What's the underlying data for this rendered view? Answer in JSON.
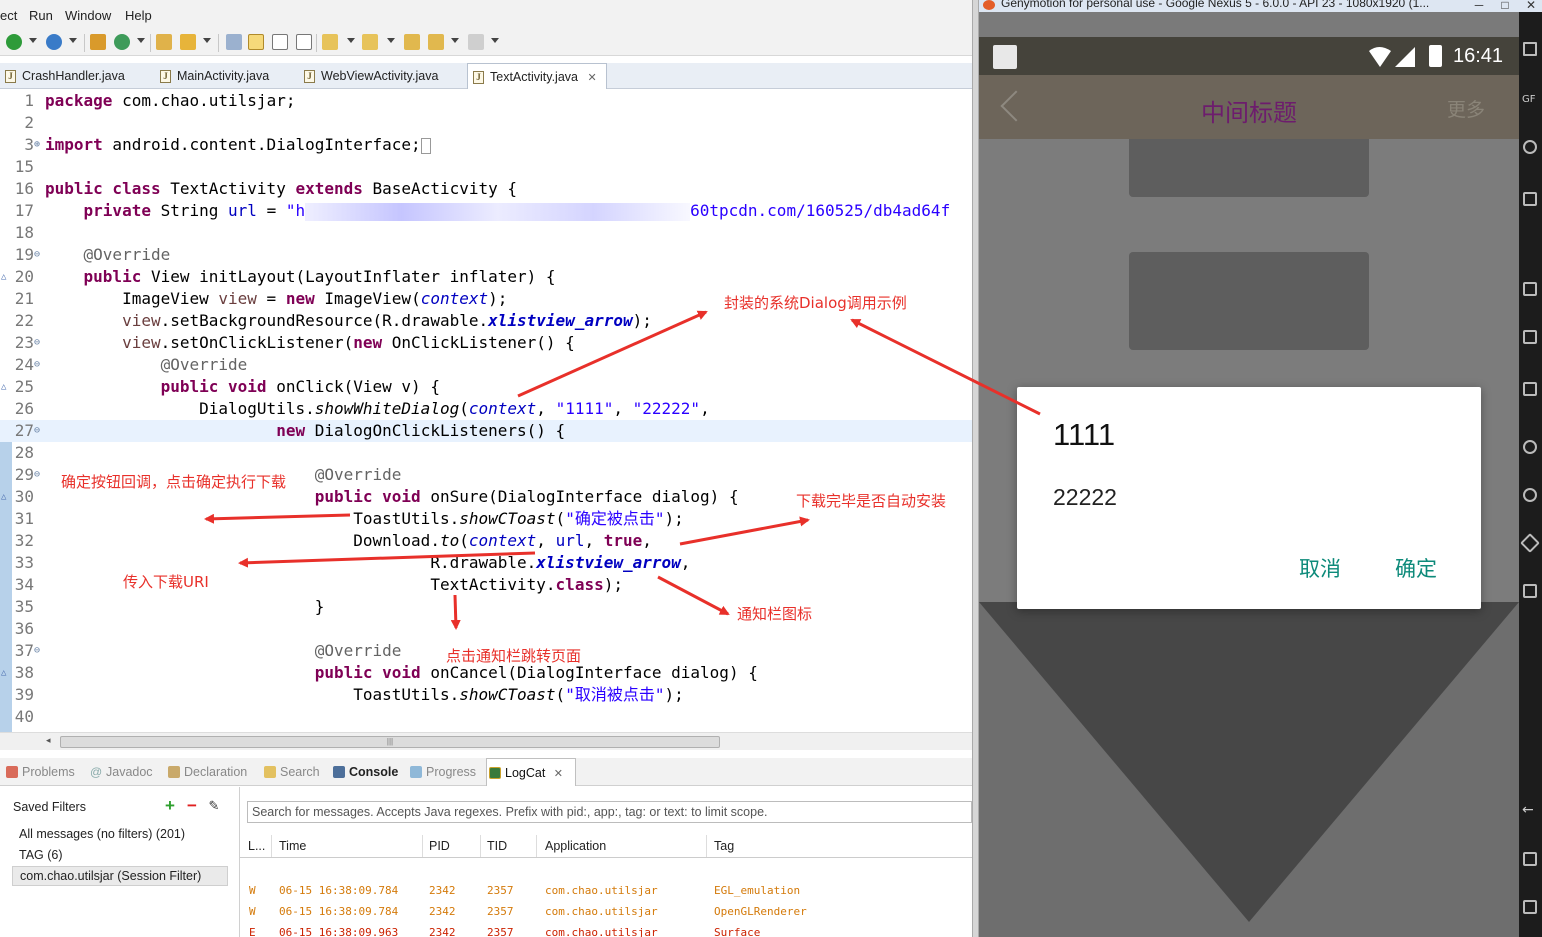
{
  "ide": {
    "menu": [
      "ect",
      "Run",
      "Window",
      "Help"
    ],
    "editor_tabs": [
      "CrashHandler.java",
      "MainActivity.java",
      "WebViewActivity.java",
      "TextActivity.java"
    ],
    "code_lines": [
      {
        "n": "1",
        "html": "<span class='kw'>package</span> com.chao.utilsjar;"
      },
      {
        "n": "2",
        "html": ""
      },
      {
        "n": "3",
        "html": "<span class='kw'>import</span> android.content.DialogInterface;<span style='display:inline-block;width:10px;height:16px;border:1px solid #999;vertical-align:middle;'></span>",
        "fold": "⊕"
      },
      {
        "n": "15",
        "html": ""
      },
      {
        "n": "16",
        "html": "<span class='kw'>public class</span> TextActivity <span class='kw'>extends</span> BaseActicvity {"
      },
      {
        "n": "17",
        "html": "    <span class='kw'>private</span> String <span class='fld'>url</span> = <span class='str'>\"h</span><span class='blur' style='width:385px'></span><span class='str'>60tpcdn.com/160525/db4ad64f</span>"
      },
      {
        "n": "18",
        "html": ""
      },
      {
        "n": "19",
        "html": "    <span class='ann'>@Override</span>",
        "fold": "⊖"
      },
      {
        "n": "20",
        "html": "    <span class='kw'>public</span> View initLayout(LayoutInflater inflater) {",
        "ov": "△"
      },
      {
        "n": "21",
        "html": "        ImageView <span style='color:#6a3e3e'>view</span> = <span class='kw'>new</span> ImageView(<span class='fld st'>context</span>);"
      },
      {
        "n": "22",
        "html": "        <span style='color:#6a3e3e'>view</span>.setBackgroundResource(R.drawable.<span class='sfld'>xlistview_arrow</span>);"
      },
      {
        "n": "23",
        "html": "        <span style='color:#6a3e3e'>view</span>.setOnClickListener(<span class='kw'>new</span> OnClickListener() {",
        "fold": "⊖"
      },
      {
        "n": "24",
        "html": "            <span class='ann'>@Override</span>",
        "fold": "⊖"
      },
      {
        "n": "25",
        "html": "            <span class='kw'>public void</span> onClick(View v) {",
        "ov": "△"
      },
      {
        "n": "26",
        "html": "                DialogUtils.<span class='st'>showWhiteDialog</span>(<span class='fld st'>context</span>, <span class='str'>\"1111\"</span>, <span class='str'>\"22222\"</span>,"
      },
      {
        "n": "27",
        "html": "                        <span class='kw'>new</span> DialogOnClickListeners() {",
        "fold": "⊖",
        "current": true
      },
      {
        "n": "28",
        "html": ""
      },
      {
        "n": "29",
        "html": "                            <span class='ann'>@Override</span>",
        "fold": "⊖"
      },
      {
        "n": "30",
        "html": "                            <span class='kw'>public void</span> onSure(DialogInterface dialog) {",
        "ov": "△"
      },
      {
        "n": "31",
        "html": "                                ToastUtils.<span class='st'>showCToast</span>(<span class='str'>\"确定被点击\"</span>);"
      },
      {
        "n": "32",
        "html": "                                Download.<span class='st'>to</span>(<span class='fld st'>context</span>, <span class='fld'>url</span>, <span class='kw'>true</span>,"
      },
      {
        "n": "33",
        "html": "                                        R.drawable.<span class='sfld'>xlistview_arrow</span>,"
      },
      {
        "n": "34",
        "html": "                                        TextActivity.<span class='kw'>class</span>);"
      },
      {
        "n": "35",
        "html": "                            }"
      },
      {
        "n": "36",
        "html": ""
      },
      {
        "n": "37",
        "html": "                            <span class='ann'>@Override</span>",
        "fold": "⊖"
      },
      {
        "n": "38",
        "html": "                            <span class='kw'>public void</span> onCancel(DialogInterface dialog) {",
        "ov": "△"
      },
      {
        "n": "39",
        "html": "                                ToastUtils.<span class='st'>showCToast</span>(<span class='str'>\"取消被点击\"</span>);"
      },
      {
        "n": "40",
        "html": ""
      }
    ],
    "bottom_tabs": [
      "Problems",
      "Javadoc",
      "Declaration",
      "Search",
      "Console",
      "Progress",
      "LogCat"
    ],
    "saved_filters": {
      "title": "Saved Filters",
      "items": [
        "All messages (no filters) (201)",
        "TAG (6)",
        "com.chao.utilsjar (Session Filter)"
      ]
    },
    "logcat": {
      "search_placeholder": "Search for messages. Accepts Java regexes. Prefix with pid:, app:, tag: or text: to limit scope.",
      "columns": [
        "L...",
        "Time",
        "PID",
        "TID",
        "Application",
        "Tag"
      ],
      "rows": [
        [
          "W",
          "06-15 16:38:09.784",
          "2342",
          "2357",
          "com.chao.utilsjar",
          "EGL_emulation"
        ],
        [
          "W",
          "06-15 16:38:09.784",
          "2342",
          "2357",
          "com.chao.utilsjar",
          "OpenGLRenderer"
        ],
        [
          "E",
          "06-15 16:38:09.963",
          "2342",
          "2357",
          "com.chao.utilsjar",
          "Surface"
        ]
      ]
    }
  },
  "annotations": {
    "dialog_example": "封装的系统Dialog调用示例",
    "sure_callback": "确定按钮回调，点击确定执行下载",
    "auto_install": "下载完毕是否自动安装",
    "pass_uri": "传入下载URI",
    "notify_icon": "通知栏图标",
    "notify_jump": "点击通知栏跳转页面"
  },
  "emulator": {
    "window_title": "Genymotion for personal use - Google Nexus 5 - 6.0.0 - API 23 - 1080x1920 (1...",
    "status_time": "16:41",
    "app_title": "中间标题",
    "app_more": "更多",
    "dialog": {
      "title": "1111",
      "message": "22222",
      "cancel": "取消",
      "confirm": "确定"
    },
    "sidebar_label": "GF"
  },
  "colors": {
    "keyword": "#7f0055",
    "string": "#2a00ff",
    "annotation_red": "#e8302a",
    "dialog_button": "#0d8a7a",
    "app_title": "#6d1c6d"
  }
}
